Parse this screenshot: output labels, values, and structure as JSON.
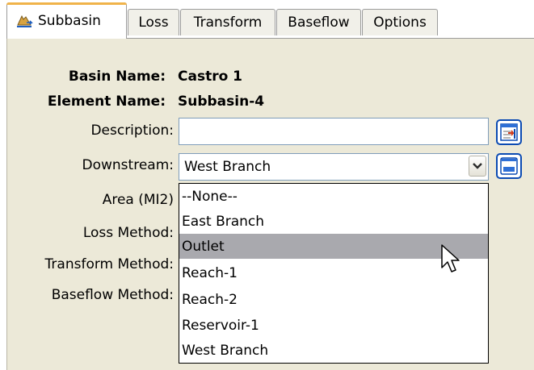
{
  "tabs": [
    {
      "label": "Subbasin",
      "active": true
    },
    {
      "label": "Loss"
    },
    {
      "label": "Transform"
    },
    {
      "label": "Baseflow"
    },
    {
      "label": "Options"
    }
  ],
  "form": {
    "basin_name_label": "Basin Name:",
    "basin_name_value": "Castro 1",
    "element_name_label": "Element Name:",
    "element_name_value": "Subbasin-4",
    "description_label": "Description:",
    "description_value": "",
    "downstream_label": "Downstream:",
    "downstream_value": "West Branch",
    "area_label": "Area (MI2)",
    "loss_method_label": "Loss Method:",
    "transform_method_label": "Transform Method:",
    "baseflow_method_label": "Baseflow Method:"
  },
  "dropdown": {
    "options": [
      "--None--",
      "East Branch",
      "Outlet",
      "Reach-1",
      "Reach-2",
      "Reservoir-1",
      "West Branch"
    ],
    "highlighted": "Outlet"
  },
  "icons": {
    "subbasin_tab_icon": "subbasin-icon",
    "description_button_icon": "description-editor-icon",
    "downstream_button_icon": "select-element-icon",
    "combo_arrow": "chevron-down-icon"
  },
  "colors": {
    "panel_bg": "#ece9d8",
    "active_tab_accent": "#f0b34a",
    "selected_option_bg": "#a9a9ae",
    "field_border": "#7f9db9"
  }
}
